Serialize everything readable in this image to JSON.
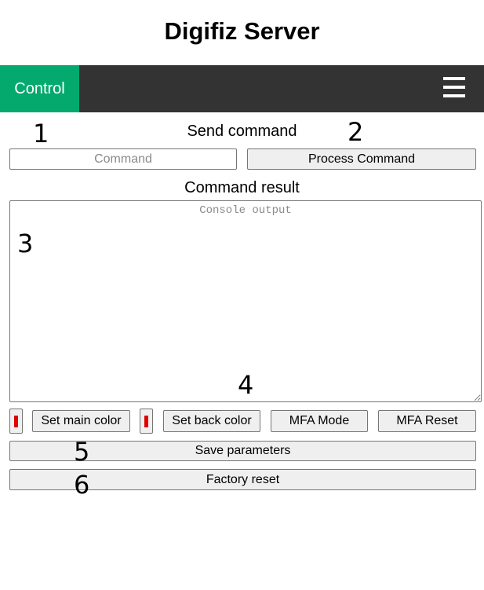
{
  "page": {
    "title": "Digifiz Server"
  },
  "navbar": {
    "active_tab": "Control",
    "menu_icon": "hamburger-menu-icon"
  },
  "send": {
    "heading": "Send command",
    "command_placeholder": "Command",
    "process_button": "Process Command"
  },
  "result": {
    "heading": "Command result",
    "console_placeholder": "Console output"
  },
  "controls": {
    "main_color_value": "#dd0000",
    "set_main_color": "Set main color",
    "back_color_value": "#dd0000",
    "set_back_color": "Set back color",
    "mfa_mode": "MFA Mode",
    "mfa_reset": "MFA Reset",
    "save_parameters": "Save parameters",
    "factory_reset": "Factory reset"
  },
  "annotations": [
    "1",
    "2",
    "3",
    "4",
    "5",
    "6"
  ],
  "colors": {
    "nav_bg": "#333333",
    "nav_active": "#04aa6d",
    "swatch_red": "#dd0000"
  }
}
